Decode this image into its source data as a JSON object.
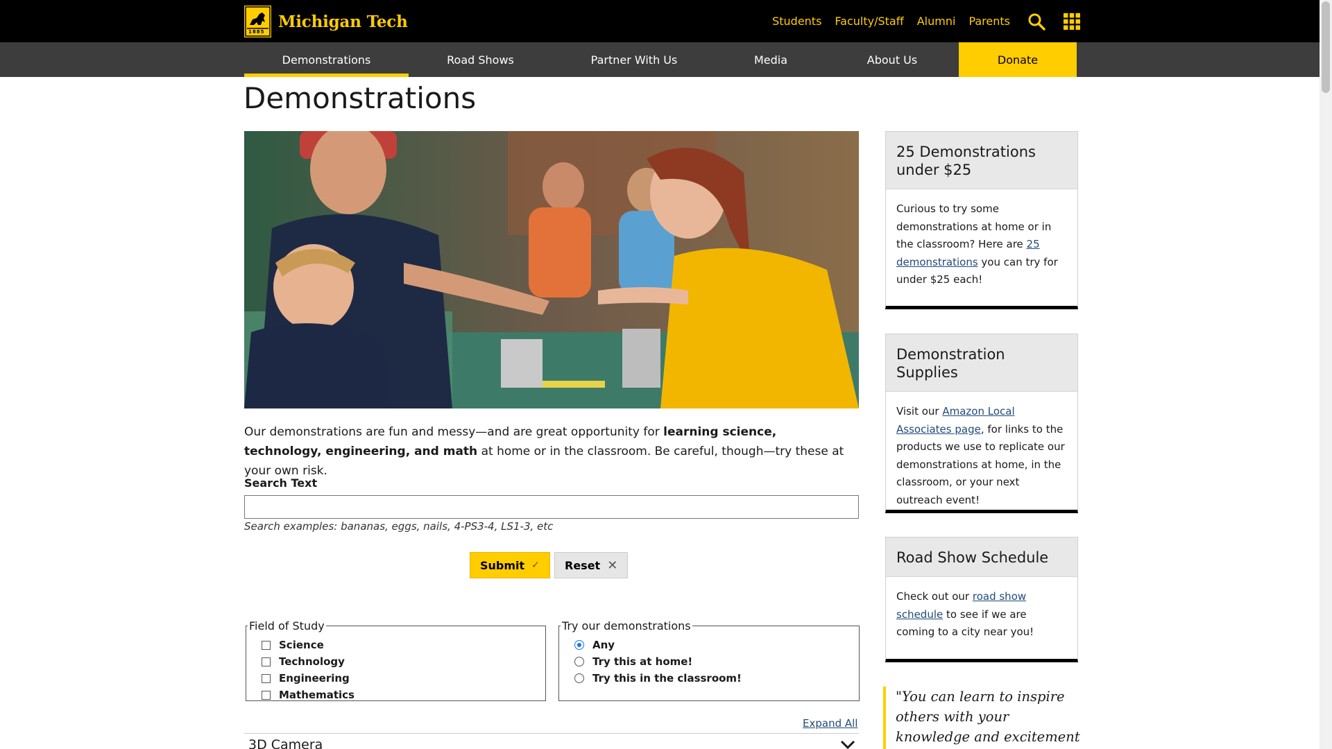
{
  "header": {
    "logo_text": "Michigan Tech",
    "logo_year": "1885",
    "audience_links": [
      "Students",
      "Faculty/Staff",
      "Alumni",
      "Parents"
    ]
  },
  "nav": {
    "items": [
      {
        "label": "Demonstrations",
        "active": true
      },
      {
        "label": "Road Shows"
      },
      {
        "label": "Partner With Us"
      },
      {
        "label": "Media"
      },
      {
        "label": "About Us"
      },
      {
        "label": "Donate"
      }
    ]
  },
  "page": {
    "title": "Demonstrations",
    "intro_part1": "Our demonstrations are fun and messy—and are great opportunity for ",
    "intro_bold": "learning science, technology, engineering, and math",
    "intro_part2": " at home or in the classroom. Be careful, though—try these at your own risk."
  },
  "search": {
    "label": "Search Text",
    "value": "",
    "hint": "Search examples: bananas, eggs, nails, 4-PS3-4, LS1-3, etc",
    "submit_label": "Submit",
    "reset_label": "Reset"
  },
  "filters": {
    "field_legend": "Field of Study",
    "fields": [
      "Science",
      "Technology",
      "Engineering",
      "Mathematics"
    ],
    "try_legend": "Try our demonstrations",
    "try_options": [
      "Any",
      "Try this at home!",
      "Try this in the classroom!"
    ],
    "try_selected": "Any"
  },
  "accordion": {
    "expand_all": "Expand All",
    "first_item": "3D Camera"
  },
  "sidebar": {
    "card1": {
      "title": "25 Demonstrations under $25",
      "text1": "Curious to try some demonstrations at home or in the classroom? Here are ",
      "link": "25 demonstrations",
      "text2": " you can try for under $25 each!"
    },
    "card2": {
      "title": "Demonstration Supplies",
      "text1": "Visit our ",
      "link": "Amazon Local Associates page",
      "text2": ", for links to the products we use to replicate our demonstrations at home, in the classroom, or your next outreach event!"
    },
    "card3": {
      "title": "Road Show Schedule",
      "text1": "Check out our ",
      "link": "road show schedule",
      "text2": " to see if we are coming to a city near you!"
    },
    "quote": "\"You can learn to inspire others with your knowledge and excitement no matter who"
  },
  "colors": {
    "brand_gold": "#ffcd00",
    "nav_gray": "#3d3d3d",
    "link_blue": "#1f4a7a"
  }
}
